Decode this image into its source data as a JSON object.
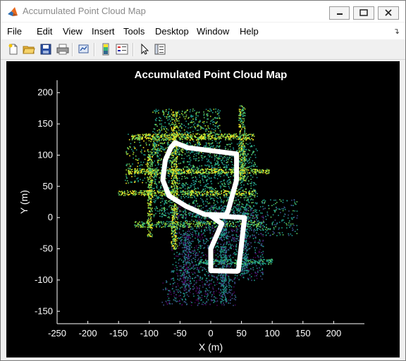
{
  "window": {
    "title": "Accumulated Point Cloud Map",
    "minimize_symbol": "minimize",
    "maximize_symbol": "maximize",
    "close_symbol": "close"
  },
  "menu": {
    "items": [
      "File",
      "Edit",
      "View",
      "Insert",
      "Tools",
      "Desktop",
      "Window",
      "Help"
    ]
  },
  "toolbar": {
    "icons": [
      "new-figure-icon",
      "open-file-icon",
      "save-icon",
      "print-icon",
      "link-plot-icon",
      "colorbar-icon",
      "legend-icon",
      "edit-plot-arrow-icon",
      "property-inspector-icon"
    ]
  },
  "colors": {
    "background": "#000000",
    "path": "#ffffff",
    "cloud_low": "#440154",
    "cloud_mid": "#21918c",
    "cloud_high": "#fde725"
  },
  "chart_data": {
    "type": "scatter",
    "title": "Accumulated Point Cloud Map",
    "xlabel": "X (m)",
    "ylabel": "Y (m)",
    "xlim": [
      -250,
      250
    ],
    "ylim": [
      -170,
      220
    ],
    "xticks": [
      -250,
      -200,
      -150,
      -100,
      -50,
      0,
      50,
      100,
      150,
      200
    ],
    "yticks": [
      -150,
      -100,
      -50,
      0,
      50,
      100,
      150,
      200
    ],
    "colormap": "parula",
    "grid": false,
    "legend": "none",
    "series": [
      {
        "kind": "trajectory",
        "x": [
          -58,
          -38,
          42,
          42,
          28,
          25,
          24,
          -10,
          -40,
          -68,
          -78,
          -74,
          -65,
          -58
        ],
        "y": [
          120,
          112,
          102,
          60,
          10,
          5,
          4,
          5,
          18,
          35,
          60,
          92,
          112,
          120
        ]
      },
      {
        "kind": "trajectory",
        "x": [
          0,
          55,
          45,
          43,
          0,
          0,
          18,
          0
        ],
        "y": [
          3,
          0,
          -85,
          -86,
          -85,
          -50,
          -10,
          3
        ]
      }
    ]
  }
}
